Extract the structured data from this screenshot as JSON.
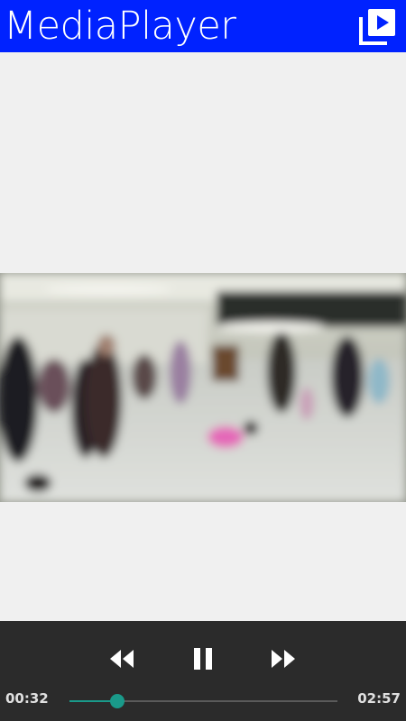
{
  "app_bar": {
    "title": "MediaPlayer",
    "playlist_icon": "playlist-play-icon",
    "background_color": "#0022ff"
  },
  "player": {
    "current_time": "00:32",
    "total_time": "02:57",
    "progress_fraction": 0.18,
    "accent_color": "#1a9a8a",
    "controls": {
      "rewind_icon": "rewind-icon",
      "pause_icon": "pause-icon",
      "fast_forward_icon": "fast-forward-icon"
    }
  }
}
